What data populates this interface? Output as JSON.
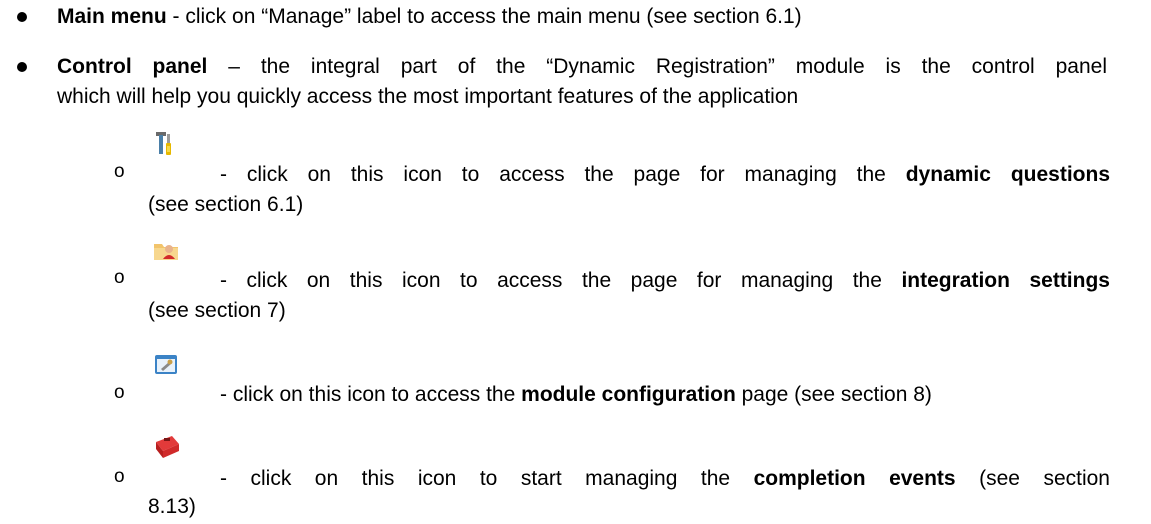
{
  "items": [
    {
      "title": "Main menu",
      "text": " - click on “Manage” label to access the main menu (see section 6.1)"
    },
    {
      "title": "Control panel",
      "text_line1": " – the integral part of the “Dynamic Registration” module is the control panel",
      "text_line2": "which will help you quickly access the most important features of the application"
    }
  ],
  "sub_marker": "o",
  "sub_items": [
    {
      "icon": "tools-icon",
      "pre": " - click on this icon to access the page for managing the ",
      "bold": "dynamic questions",
      "post": "(see section 6.1)"
    },
    {
      "icon": "user-folder-icon",
      "pre": " - click on this icon to access the page for managing the ",
      "bold": "integration settings",
      "post": "(see section 7)"
    },
    {
      "icon": "config-window-icon",
      "pre": " - click on this icon to access the ",
      "bold": "module configuration",
      "post": " page (see section 8)"
    },
    {
      "icon": "toolbox-icon",
      "pre": " - click on this icon to start managing the ",
      "bold": "completion events",
      "post_line1": " (see section",
      "post_line2": "8.13)"
    }
  ]
}
